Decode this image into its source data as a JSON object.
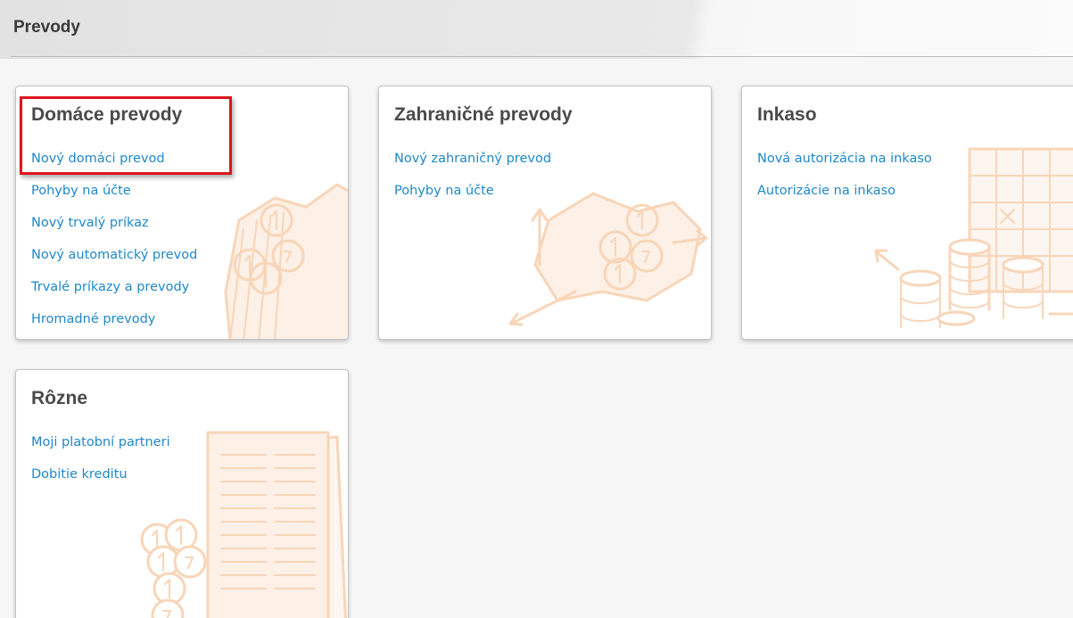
{
  "header": {
    "title": "Prevody"
  },
  "sections": [
    {
      "title": "Domáce prevody",
      "links": [
        "Nový domáci prevod",
        "Pohyby na účte",
        "Nový trvalý príkaz",
        "Nový automatický prevod",
        "Trvalé príkazy a prevody",
        "Hromadné prevody"
      ],
      "background_icon": "coins-map-icon"
    },
    {
      "title": "Zahraničné prevody",
      "links": [
        "Nový zahraničný prevod",
        "Pohyby na účte"
      ],
      "background_icon": "map-arrows-coins-icon"
    },
    {
      "title": "Inkaso",
      "links": [
        "Nová autorizácia na inkaso",
        "Autorizácie na inkaso"
      ],
      "background_icon": "calendar-coin-stacks-icon"
    },
    {
      "title": "Rôzne",
      "links": [
        "Moji platobní partneri",
        "Dobitie kreditu"
      ],
      "background_icon": "document-coins-icon"
    }
  ],
  "colors": {
    "link": "#1e88c8",
    "title": "#4a4a4a",
    "highlight": "#e0141c",
    "icon_watermark": "#f8d5b8"
  }
}
